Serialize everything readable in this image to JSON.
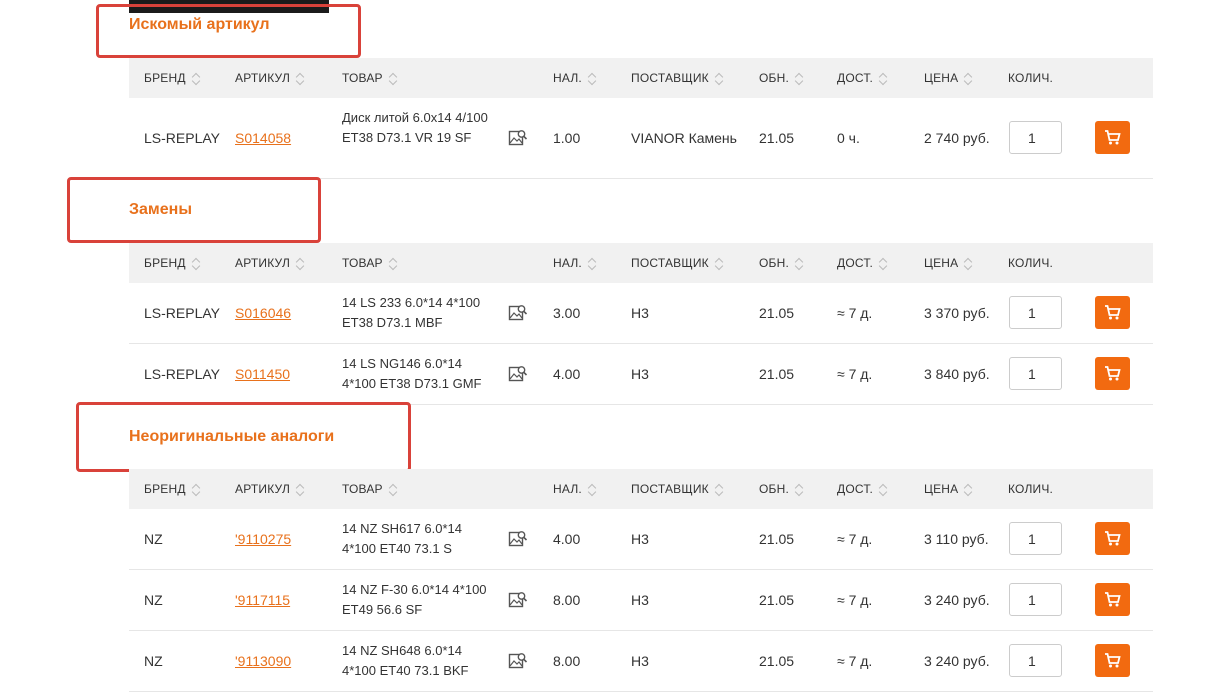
{
  "columns": {
    "brand": "БРЕНД",
    "article": "АРТИКУЛ",
    "product": "ТОВАР",
    "stock": "НАЛ.",
    "supplier": "ПОСТАВЩИК",
    "updated": "ОБН.",
    "delivery": "ДОСТ.",
    "price": "ЦЕНА",
    "qty": "КОЛИЧ."
  },
  "sections": [
    {
      "title": "Искомый артикул",
      "rows": [
        {
          "brand": "LS-REPLAY",
          "article": "S014058",
          "product": "Диск литой 6.0x14 4/100 ET38 D73.1 VR 19 SF",
          "stock": "1.00",
          "supplier": "VIANOR Камень",
          "updated": "21.05",
          "delivery": "0 ч.",
          "price": "2 740 руб.",
          "qty": "1"
        }
      ]
    },
    {
      "title": "Замены",
      "rows": [
        {
          "brand": "LS-REPLAY",
          "article": "S016046",
          "product": "14 LS 233 6.0*14 4*100 ET38 D73.1 MBF",
          "stock": "3.00",
          "supplier": "Н3",
          "updated": "21.05",
          "delivery": "≈ 7 д.",
          "price": "3 370 руб.",
          "qty": "1"
        },
        {
          "brand": "LS-REPLAY",
          "article": "S011450",
          "product": "14 LS NG146 6.0*14 4*100 ET38 D73.1 GMF",
          "stock": "4.00",
          "supplier": "Н3",
          "updated": "21.05",
          "delivery": "≈ 7 д.",
          "price": "3 840 руб.",
          "qty": "1"
        }
      ]
    },
    {
      "title": "Неоригинальные аналоги",
      "rows": [
        {
          "brand": "NZ",
          "article": "'9110275",
          "product": "14 NZ SH617 6.0*14 4*100 ET40 73.1 S",
          "stock": "4.00",
          "supplier": "Н3",
          "updated": "21.05",
          "delivery": "≈ 7 д.",
          "price": "3 110 руб.",
          "qty": "1"
        },
        {
          "brand": "NZ",
          "article": "'9117115",
          "product": "14 NZ F-30 6.0*14 4*100 ET49 56.6 SF",
          "stock": "8.00",
          "supplier": "Н3",
          "updated": "21.05",
          "delivery": "≈ 7 д.",
          "price": "3 240 руб.",
          "qty": "1"
        },
        {
          "brand": "NZ",
          "article": "'9113090",
          "product": "14 NZ SH648 6.0*14 4*100 ET40 73.1 BKF",
          "stock": "8.00",
          "supplier": "Н3",
          "updated": "21.05",
          "delivery": "≈ 7 д.",
          "price": "3 240 руб.",
          "qty": "1"
        }
      ]
    }
  ],
  "colors": {
    "accent": "#e8711c",
    "cart": "#f26a10",
    "highlight": "#d9423a",
    "header_bg": "#f1f1f1"
  },
  "icons": {
    "image": "image-search-icon",
    "cart": "cart-icon",
    "sort": "sort-icon"
  }
}
